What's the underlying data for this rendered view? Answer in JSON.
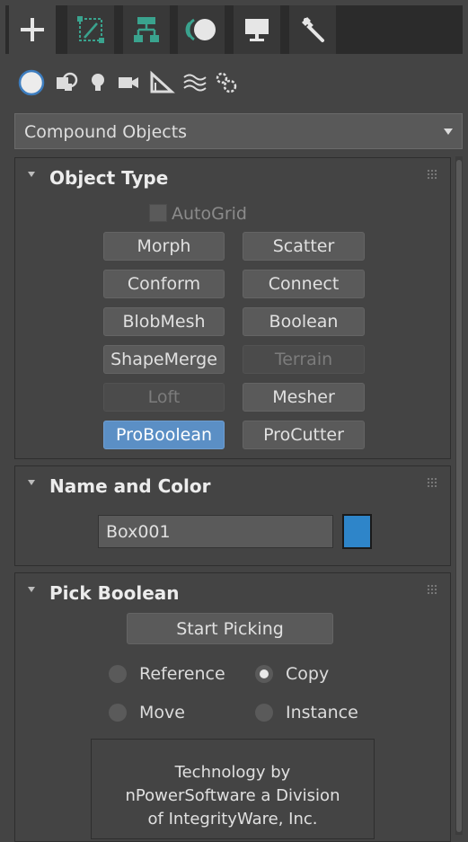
{
  "command_tabs": [
    {
      "name": "create",
      "icon": "plus-icon",
      "active": true
    },
    {
      "name": "modify",
      "icon": "modify-icon",
      "active": false
    },
    {
      "name": "hierarchy",
      "icon": "hierarchy-icon",
      "active": false
    },
    {
      "name": "motion",
      "icon": "motion-icon",
      "active": false
    },
    {
      "name": "display",
      "icon": "display-icon",
      "active": false
    },
    {
      "name": "utilities",
      "icon": "wrench-icon",
      "active": false
    }
  ],
  "categories": [
    "geometry-icon",
    "shapes-icon",
    "lights-icon",
    "cameras-icon",
    "helpers-icon",
    "spacewarps-icon",
    "systems-icon"
  ],
  "dropdown": {
    "value": "Compound Objects"
  },
  "object_type": {
    "title": "Object Type",
    "autogrid": "AutoGrid",
    "buttons": [
      {
        "label": "Morph",
        "state": "normal"
      },
      {
        "label": "Scatter",
        "state": "normal"
      },
      {
        "label": "Conform",
        "state": "normal"
      },
      {
        "label": "Connect",
        "state": "normal"
      },
      {
        "label": "BlobMesh",
        "state": "normal"
      },
      {
        "label": "Boolean",
        "state": "normal"
      },
      {
        "label": "ShapeMerge",
        "state": "normal"
      },
      {
        "label": "Terrain",
        "state": "disabled"
      },
      {
        "label": "Loft",
        "state": "disabled"
      },
      {
        "label": "Mesher",
        "state": "normal"
      },
      {
        "label": "ProBoolean",
        "state": "active"
      },
      {
        "label": "ProCutter",
        "state": "normal"
      }
    ]
  },
  "name_color": {
    "title": "Name and Color",
    "name_value": "Box001",
    "color": "#2e85c9"
  },
  "pick_boolean": {
    "title": "Pick Boolean",
    "start_picking": "Start Picking",
    "radios": [
      {
        "label": "Reference",
        "checked": false
      },
      {
        "label": "Copy",
        "checked": true
      },
      {
        "label": "Move",
        "checked": false
      },
      {
        "label": "Instance",
        "checked": false
      }
    ],
    "info_lines": [
      "Technology by",
      "nPowerSoftware a Division",
      "of IntegrityWare, Inc."
    ]
  },
  "colors": {
    "accent": "#5b8fc5",
    "panel": "#444444",
    "icon_teal": "#3aa38e"
  }
}
